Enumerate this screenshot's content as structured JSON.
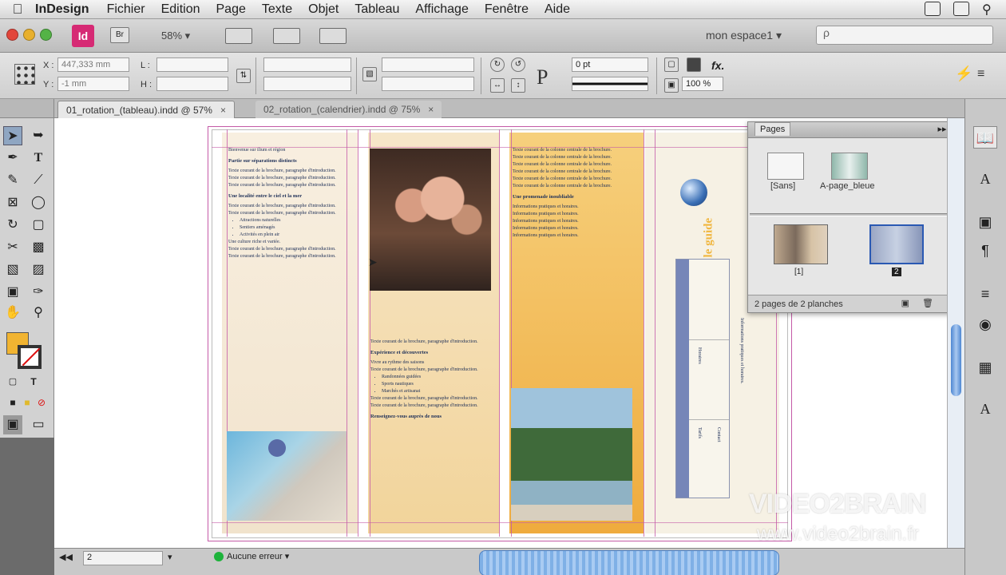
{
  "menubar": {
    "app_name": "InDesign",
    "items": [
      "Fichier",
      "Edition",
      "Page",
      "Texte",
      "Objet",
      "Tableau",
      "Affichage",
      "Fenêtre",
      "Aide"
    ]
  },
  "appbar": {
    "app_icon": "Id",
    "bridge_icon": "Br",
    "zoom": "58%",
    "workspace": "mon espace1",
    "search_placeholder": "ρ"
  },
  "control": {
    "x_label": "X :",
    "x_value": "447,333 mm",
    "y_label": "Y :",
    "y_value": "-1 mm",
    "w_label": "L :",
    "h_label": "H :",
    "stroke_weight": "0 pt",
    "scale": "100 %",
    "fx_label": "fx."
  },
  "tabs": [
    {
      "label": "01_rotation_(tableau).indd @ 57%",
      "close": "×"
    },
    {
      "label": "02_rotation_(calendrier).indd @ 75%",
      "close": "×"
    }
  ],
  "tools": [
    "selection-tool",
    "direct-selection-tool",
    "pen-tool",
    "type-tool",
    "pencil-tool",
    "line-tool",
    "rectangle-frame-tool",
    "ellipse-tool",
    "rotate-tool",
    "scale-tool",
    "scissors-tool",
    "free-transform-tool",
    "gradient-tool",
    "gradient-feather-tool",
    "note-tool",
    "eyedropper-tool",
    "hand-tool",
    "zoom-tool"
  ],
  "document": {
    "col1_lines": [
      "Bienvenue sur ilium et région",
      "Partie sur séparations distincts",
      "Texte courant de la brochure, paragraphe d'introduction.",
      "Une localité entre le ciel et la mer",
      "Attractions naturelles",
      "Sentiers aménagés",
      "Activités en plein air",
      "Une culture riche et variée."
    ],
    "col2_lines": [
      "Expérience et découvertes",
      "Vivre au rythme des saisons",
      "Randonnées guidées",
      "Sports nautiques",
      "Marchés et artisanat",
      "Renseignez-vous auprès de nous"
    ],
    "col3_lines": [
      "Texte courant de la colonne centrale de la brochure.",
      "Une promenade inoubliable",
      "Informations pratiques et horaires."
    ],
    "vertical_title": "Votre séjour dans notre région : ouvrez le guide",
    "table_labels": [
      "Horaires",
      "Tarifs",
      "Contact"
    ]
  },
  "pages_panel": {
    "title": "Pages",
    "masters": [
      "[Sans]",
      "A-page_bleue"
    ],
    "spreads": [
      "[1]",
      "2"
    ],
    "footer": "2 pages de 2 planches"
  },
  "statusbar": {
    "page": "2",
    "errors": "Aucune erreur"
  },
  "watermark": {
    "line1": "VIDEO2BRAIN",
    "line2": "www.video2brain.fr"
  },
  "colors": {
    "fill": "#f1b431",
    "accent": "#d62a74",
    "guides": "#c45aa7",
    "scroll": "#4e87d2"
  }
}
